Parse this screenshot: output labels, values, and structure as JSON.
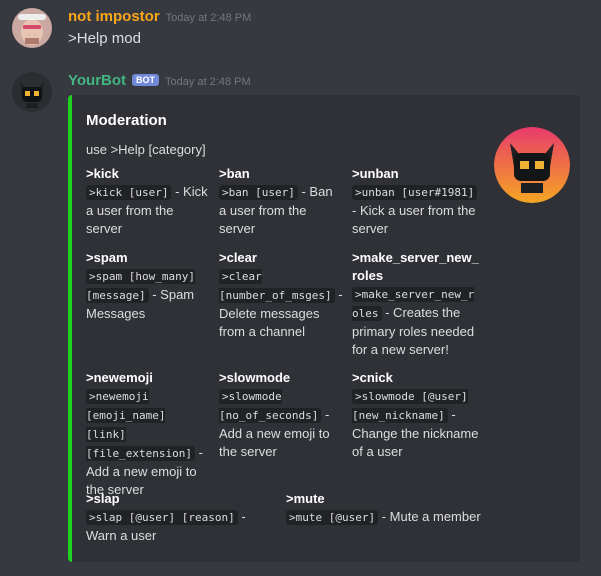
{
  "message1": {
    "username": "not impostor",
    "timestamp": "Today at 2:48 PM",
    "text": ">Help mod",
    "username_color": "#faa61a"
  },
  "message2": {
    "username": "YourBot",
    "badge": "BOT",
    "timestamp": "Today at 2:48 PM",
    "username_color": "#43b581"
  },
  "embed": {
    "accent_color": "#1fd21f",
    "title": "Moderation",
    "description": "use >Help [category]",
    "fields": [
      {
        "name": ">kick",
        "code": ">kick [user]",
        "text": " - Kick a user from the server"
      },
      {
        "name": ">ban",
        "code": ">ban [user]",
        "text": " - Ban a user from the server"
      },
      {
        "name": ">unban",
        "code": ">unban [user#1981]",
        "text": " - Kick a user from the server"
      },
      {
        "name": ">spam",
        "code": ">spam [how_many] [message]",
        "text": " - Spam Messages"
      },
      {
        "name": ">clear",
        "code": ">clear [number_of_msges]",
        "text": " - Delete messages from a channel"
      },
      {
        "name": ">make_server_new_roles",
        "code": ">make_server_new_roles",
        "text": " - Creates the primary roles needed for a new server!"
      },
      {
        "name": ">newemoji",
        "code": ">newemoji [emoji_name] [link] [file_extension]",
        "text": " - Add a new emoji to the server"
      },
      {
        "name": ">slowmode",
        "code": ">slowmode [no_of_seconds]",
        "text": " - Add a new emoji to the server"
      },
      {
        "name": ">cnick",
        "code": ">slowmode [@user] [new_nickname]",
        "text": " - Change the nickname of a user"
      },
      {
        "name": ">slap",
        "code": ">slap [@user] [reason]",
        "text": " - Warn a user"
      },
      {
        "name": ">mute",
        "code": ">mute [@user]",
        "text": " - Mute a member"
      }
    ]
  }
}
